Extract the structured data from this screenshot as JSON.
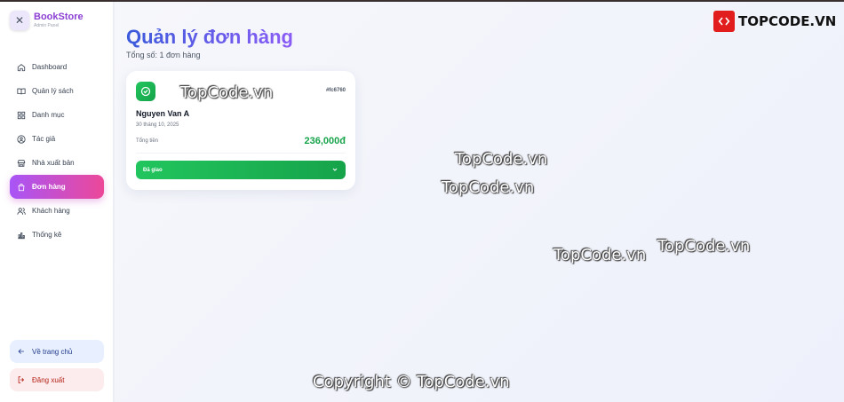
{
  "brand": {
    "title": "BookStore",
    "subtitle": "Admin Panel",
    "close_icon": "close-icon"
  },
  "nav": {
    "items": [
      {
        "label": "Dashboard",
        "icon": "home-icon",
        "active": false
      },
      {
        "label": "Quản lý sách",
        "icon": "book-icon",
        "active": false
      },
      {
        "label": "Danh mục",
        "icon": "grid-icon",
        "active": false
      },
      {
        "label": "Tác giả",
        "icon": "user-circle-icon",
        "active": false
      },
      {
        "label": "Nhà xuất bản",
        "icon": "store-icon",
        "active": false
      },
      {
        "label": "Đơn hàng",
        "icon": "shopping-bag-icon",
        "active": true
      },
      {
        "label": "Khách hàng",
        "icon": "users-icon",
        "active": false
      },
      {
        "label": "Thống kê",
        "icon": "bar-chart-icon",
        "active": false
      }
    ],
    "home_label": "Về trang chủ",
    "logout_label": "Đăng xuất"
  },
  "page": {
    "title": "Quản lý đơn hàng",
    "subtitle": "Tổng số: 1 đơn hàng"
  },
  "order": {
    "id": "#fc6760",
    "customer": "Nguyen Van A",
    "date": "30 tháng 10, 2025",
    "total_label": "Tổng tiền",
    "total_value": "236,000đ",
    "status": "Đã giao"
  },
  "watermarks": {
    "text": "TopCode.vn",
    "copyright": "Copyright © TopCode.vn",
    "logo_text": "TOPCODE.VN"
  },
  "colors": {
    "accent_active": "#c04fe0",
    "success": "#16a34a",
    "title_gradient_start": "#3b5bdb"
  }
}
